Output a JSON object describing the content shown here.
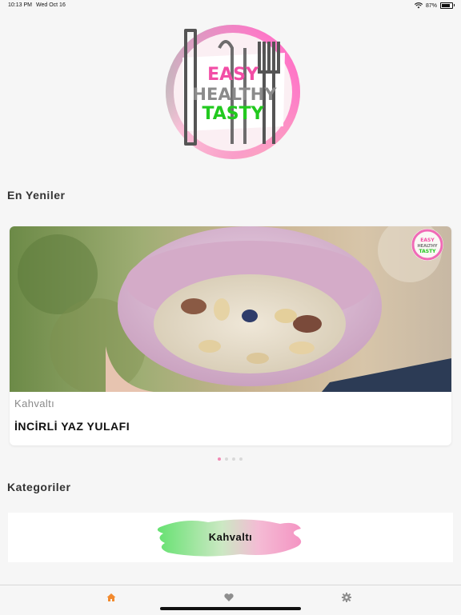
{
  "status": {
    "time": "10:13 PM",
    "date": "Wed Oct 16",
    "battery": "87%",
    "battery_level": 0.87
  },
  "logo": {
    "line1": "EASY",
    "line2": "HEALTHY",
    "line3": "TASTY"
  },
  "sections": {
    "latest": "En Yeniler",
    "categories": "Kategoriler"
  },
  "featured": {
    "category": "Kahvaltı",
    "title": "İNCİRLİ YAZ YULAFI",
    "badge": {
      "line1": "EASY",
      "line2": "HEALTHY",
      "line3": "TASTY"
    }
  },
  "carousel": {
    "pages": 4,
    "active": 0
  },
  "category_cards": [
    {
      "label": "Kahvaltı"
    }
  ],
  "tabbar": {
    "items": [
      "home-icon",
      "heart-icon",
      "gear-icon"
    ],
    "active": 0
  },
  "colors": {
    "accent": "#f28a2e",
    "pink": "#f06bb6",
    "green": "#3fcf46",
    "tab_inactive": "#8e8e8e"
  }
}
